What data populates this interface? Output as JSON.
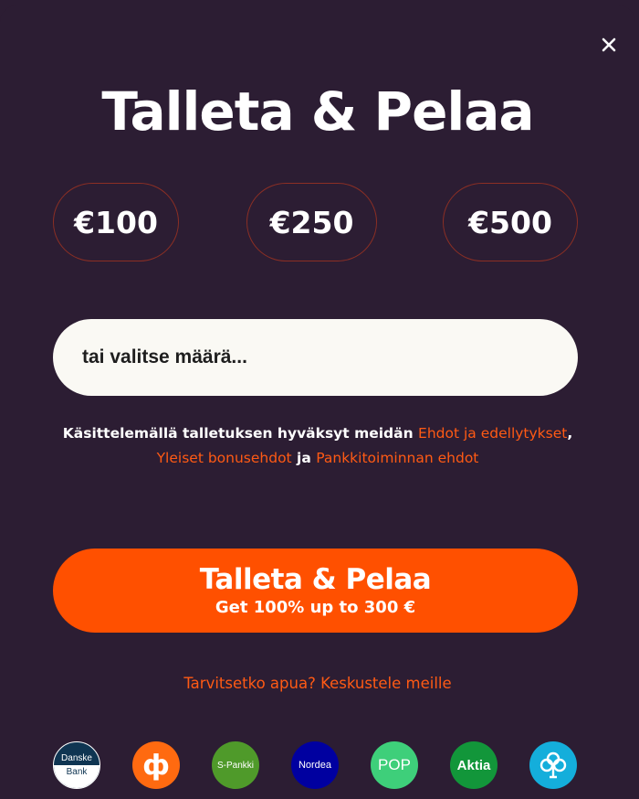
{
  "dialog": {
    "title": "Talleta & Pelaa",
    "close_label": "×"
  },
  "amounts": [
    "€100",
    "€250",
    "€500"
  ],
  "amount_input": {
    "placeholder": "tai valitse määrä..."
  },
  "terms": {
    "prefix": "Käsittelemällä talletuksen hyväksyt meidän ",
    "link_terms": "Ehdot ja edellytykset",
    "comma": ", ",
    "link_bonus": "Yleiset bonusehdot",
    "and": " ja ",
    "link_banking": "Pankkitoiminnan ehdot"
  },
  "cta": {
    "label": "Talleta & Pelaa",
    "sublabel": "Get 100% up to 300 €"
  },
  "help_link": "Tarvitsetko apua? Keskustele meille",
  "banks": [
    {
      "name": "Danske Bank",
      "line1": "Danske",
      "line2": "Bank",
      "color": "#0f3552"
    },
    {
      "name": "OP",
      "symbol": "ф",
      "color": "#ff6a10"
    },
    {
      "name": "S-Pankki",
      "label": "S-Pankki",
      "color": "#4f9a2a"
    },
    {
      "name": "Nordea",
      "label": "Nordea",
      "color": "#0000a0"
    },
    {
      "name": "POP",
      "label": "POP",
      "color": "#3ecf7a"
    },
    {
      "name": "Aktia",
      "label": "Aktia",
      "color": "#12963a"
    },
    {
      "name": "Säästöpankki",
      "icon": "clover-icon",
      "color": "#14aedb"
    }
  ],
  "colors": {
    "background": "#2c1d33",
    "accent": "#ff5000",
    "link": "#ff5a14",
    "amount_border": "#8c2f24",
    "input_bg": "#faf9f4"
  }
}
